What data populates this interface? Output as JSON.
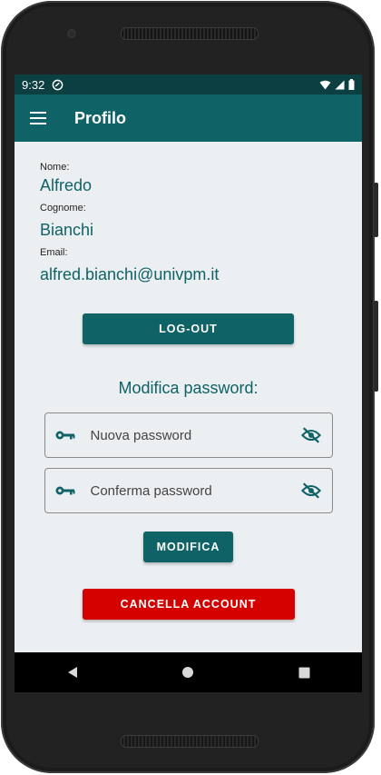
{
  "status_bar": {
    "time": "9:32"
  },
  "app_bar": {
    "title": "Profilo"
  },
  "profile": {
    "name_label": "Nome:",
    "name_value": "Alfredo",
    "surname_label": "Cognome:",
    "surname_value": "Bianchi",
    "email_label": "Email:",
    "email_value": "alfred.bianchi@univpm.it"
  },
  "buttons": {
    "logout": "LOG-OUT",
    "modify": "MODIFICA",
    "delete_account": "CANCELLA ACCOUNT"
  },
  "password_section": {
    "title": "Modifica password:",
    "new_password_placeholder": "Nuova password",
    "confirm_password_placeholder": "Conferma password"
  },
  "colors": {
    "primary": "#0f6266",
    "status_bar": "#0b3f41",
    "danger": "#d50000",
    "background": "#eceff1"
  },
  "icons": [
    "menu-icon",
    "key-icon",
    "visibility-off-icon",
    "wifi-icon",
    "signal-icon",
    "battery-icon",
    "nav-back-icon",
    "nav-home-icon",
    "nav-recents-icon"
  ]
}
